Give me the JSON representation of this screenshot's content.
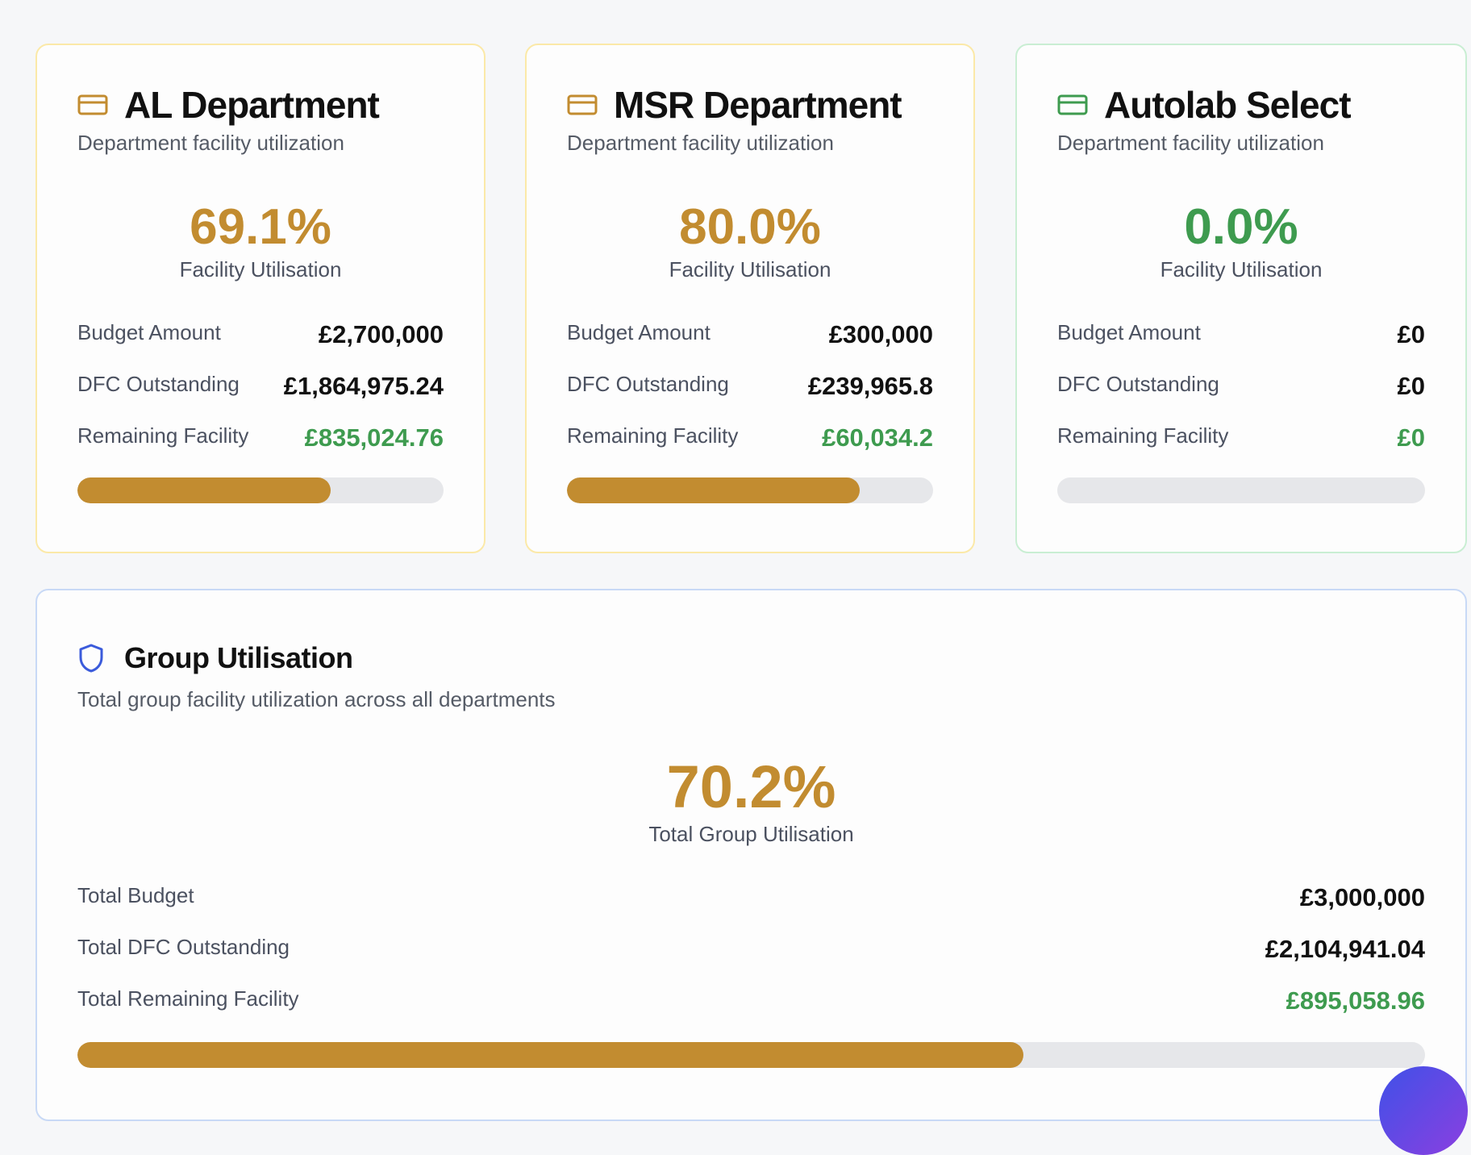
{
  "departments": [
    {
      "title": "AL Department",
      "subtitle": "Department facility utilization",
      "percent": "69.1%",
      "percent_label": "Facility Utilisation",
      "progress": 0.691,
      "accent": "#c28c30",
      "icon": "credit-card-icon",
      "rows": [
        {
          "label": "Budget Amount",
          "value": "£2,700,000"
        },
        {
          "label": "DFC Outstanding",
          "value": "£1,864,975.24"
        },
        {
          "label": "Remaining Facility",
          "value": "£835,024.76"
        }
      ]
    },
    {
      "title": "MSR Department",
      "subtitle": "Department facility utilization",
      "percent": "80.0%",
      "percent_label": "Facility Utilisation",
      "progress": 0.8,
      "accent": "#c28c30",
      "icon": "credit-card-icon",
      "rows": [
        {
          "label": "Budget Amount",
          "value": "£300,000"
        },
        {
          "label": "DFC Outstanding",
          "value": "£239,965.8"
        },
        {
          "label": "Remaining Facility",
          "value": "£60,034.2"
        }
      ]
    },
    {
      "title": "Autolab Select",
      "subtitle": "Department facility utilization",
      "percent": "0.0%",
      "percent_label": "Facility Utilisation",
      "progress": 0.0,
      "accent": "#3e9b4f",
      "icon": "credit-card-icon",
      "rows": [
        {
          "label": "Budget Amount",
          "value": "£0"
        },
        {
          "label": "DFC Outstanding",
          "value": "£0"
        },
        {
          "label": "Remaining Facility",
          "value": "£0"
        }
      ]
    }
  ],
  "group": {
    "title": "Group Utilisation",
    "subtitle": "Total group facility utilization across all departments",
    "percent": "70.2%",
    "percent_label": "Total Group Utilisation",
    "progress": 0.702,
    "accent": "#c28c30",
    "icon": "shield-icon",
    "rows": [
      {
        "label": "Total Budget",
        "value": "£3,000,000"
      },
      {
        "label": "Total DFC Outstanding",
        "value": "£2,104,941.04"
      },
      {
        "label": "Total Remaining Facility",
        "value": "£895,058.96"
      }
    ]
  },
  "colors": {
    "gold": "#c28c30",
    "green": "#3e9b4f",
    "blue_icon": "#3b5bdb"
  }
}
